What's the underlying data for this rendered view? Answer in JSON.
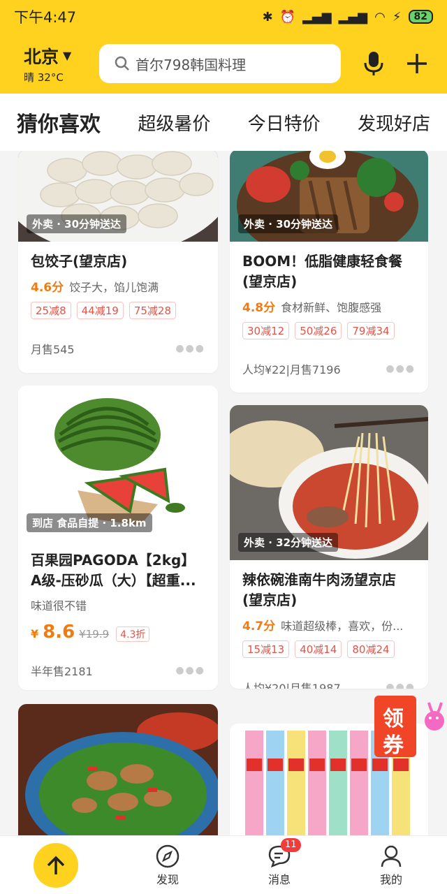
{
  "status": {
    "time": "下午4:47",
    "battery": "82"
  },
  "header": {
    "city": "北京",
    "weather": "晴 32°C",
    "search_placeholder": "首尔798韩国料理"
  },
  "tabs": [
    "猜你喜欢",
    "超级暑价",
    "今日特价",
    "发现好店"
  ],
  "cards": {
    "c1": {
      "badge": "外卖 · 30分钟送达",
      "title": "包饺子(望京店)",
      "score": "4.6分",
      "tagline": "饺子大，馅儿饱满",
      "promos": [
        "25减8",
        "44减19",
        "75减28"
      ],
      "meta": "月售545"
    },
    "c2": {
      "badge": "外卖 · 30分钟送达",
      "title": "BOOM！低脂健康轻食餐(望京店)",
      "score": "4.8分",
      "tagline": "食材新鲜、饱腹感强",
      "promos": [
        "30减12",
        "50减26",
        "79减34"
      ],
      "meta": "人均¥22|月售7196"
    },
    "c3": {
      "badge": "到店 食品自提 · 1.8km",
      "title": "百果园PAGODA【2kg】A级-压砂瓜（大）【超重...",
      "desc": "味道很不错",
      "currency": "¥",
      "price": "8.6",
      "old_price": "¥19.9",
      "discount": "4.3折",
      "meta": "半年售2181"
    },
    "c4": {
      "badge": "外卖 · 32分钟送达",
      "title": "辣依碗淮南牛肉汤望京店(望京店)",
      "score": "4.7分",
      "tagline": "味道超级棒，喜欢，份...",
      "promos": [
        "15减13",
        "40减14",
        "80减24"
      ],
      "meta": "人均¥20|月售1987"
    }
  },
  "coupon": {
    "line1": "领",
    "line2": "券"
  },
  "nav": {
    "discover": "发现",
    "messages": "消息",
    "messages_badge": "11",
    "mine": "我的"
  },
  "colors": {
    "brand": "#ffd21f",
    "accent": "#f07b12",
    "promo": "#e55246"
  }
}
